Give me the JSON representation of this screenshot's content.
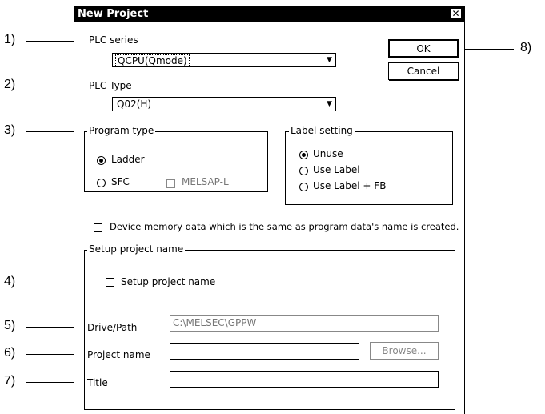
{
  "dialog": {
    "title": "New Project",
    "close_symbol": "✕",
    "plc_series_label": "PLC series",
    "plc_series_value": "QCPU(Qmode)",
    "plc_type_label": "PLC Type",
    "plc_type_value": "Q02(H)",
    "ok_label": "OK",
    "cancel_label": "Cancel",
    "program_type": {
      "title": "Program type",
      "ladder": "Ladder",
      "sfc": "SFC",
      "melsap": "MELSAP-L"
    },
    "label_setting": {
      "title": "Label setting",
      "unuse": "Unuse",
      "use_label": "Use Label",
      "use_label_fb": "Use Label + FB"
    },
    "device_memory_label": "Device memory data which is the same as program data's name is created.",
    "setup_project": {
      "group_title": "Setup project name",
      "checkbox_label": "Setup project name",
      "drive_path_label": "Drive/Path",
      "drive_path_value": "C:\\MELSEC\\GPPW",
      "project_name_label": "Project name",
      "project_name_value": "",
      "browse_label": "Browse...",
      "title_label": "Title",
      "title_value": ""
    }
  },
  "callouts": [
    "1)",
    "2)",
    "3)",
    "4)",
    "5)",
    "6)",
    "7)",
    "8)"
  ]
}
